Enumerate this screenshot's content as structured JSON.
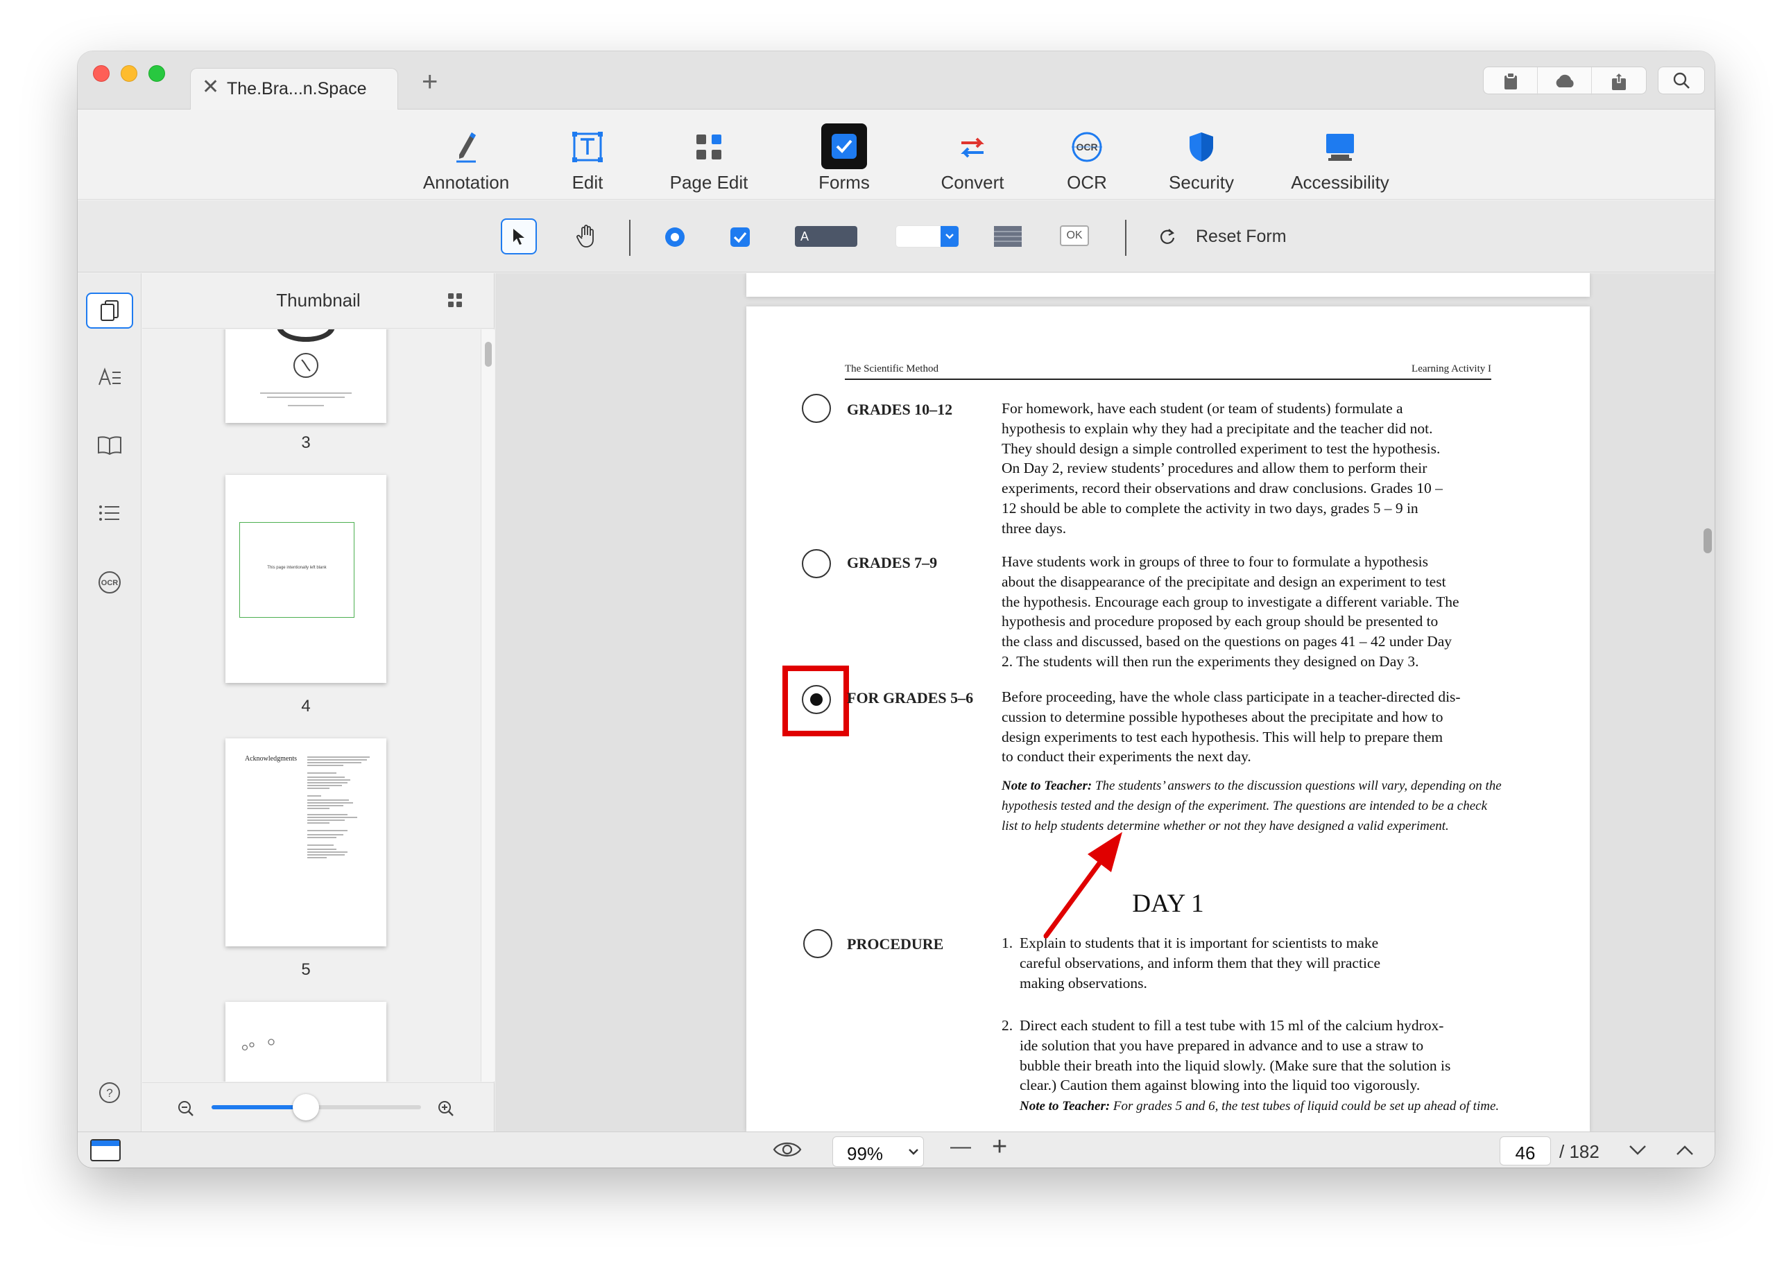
{
  "tab": {
    "title": "The.Bra...n.Space",
    "close": "✕",
    "new": "+"
  },
  "titlebar_buttons": [
    "clipboard-icon",
    "cloud-icon",
    "share-icon"
  ],
  "main_toolbar": [
    {
      "label": "Annotation",
      "icon": "pen-icon"
    },
    {
      "label": "Edit",
      "icon": "text-edit-icon"
    },
    {
      "label": "Page Edit",
      "icon": "grid-icon"
    },
    {
      "label": "Forms",
      "icon": "checkbox-icon",
      "active": true
    },
    {
      "label": "Convert",
      "icon": "convert-icon"
    },
    {
      "label": "OCR",
      "icon": "ocr-icon"
    },
    {
      "label": "Security",
      "icon": "shield-icon"
    },
    {
      "label": "Accessibility",
      "icon": "monitor-icon"
    }
  ],
  "form_toolbar": {
    "tools": [
      "select-arrow",
      "hand",
      "radio-button",
      "checkbox",
      "text-field",
      "dropdown",
      "list-box",
      "button"
    ],
    "text_field_sample": "A",
    "button_sample": "OK",
    "reset_label": "Reset Form"
  },
  "sidebar": {
    "title": "Thumbnail",
    "thumbs": [
      {
        "number": "3"
      },
      {
        "number": "4",
        "text": "This page intentionally left blank"
      },
      {
        "number": "5",
        "heading": "Acknowledgments"
      }
    ],
    "zoom_slider": 0.45
  },
  "document": {
    "header_left": "The Scientific Method",
    "header_right": "Learning Activity I",
    "sections": [
      {
        "heading": "GRADES 10–12",
        "checked": false,
        "lines": [
          "For homework, have each student (or team of students) formulate a",
          "hypothesis to explain why they had a precipitate and the teacher did not.",
          "They should design a simple controlled experiment to test the hypothesis.",
          "On Day 2, review students’ procedures and allow them to perform their",
          "experiments, record their observations and draw conclusions. Grades 10 –",
          "12 should be able to complete the activity in two days, grades 5 – 9 in",
          "three days."
        ]
      },
      {
        "heading": "GRADES 7–9",
        "checked": false,
        "lines": [
          "Have students work in groups of three to four to formulate a hypothesis",
          "about the disappearance of the precipitate and design an experiment to test",
          "the hypothesis. Encourage each group to investigate a different variable. The",
          "hypothesis and procedure proposed by each group should be presented to",
          "the class and discussed, based on the questions on pages 41 – 42 under Day",
          "2. The students will then run the experiments they designed on Day 3."
        ]
      },
      {
        "heading": "FOR GRADES 5–6",
        "checked": true,
        "lines": [
          "Before proceeding, have the whole class participate in a teacher-directed dis-",
          "cussion to determine possible hypotheses about the precipitate and how to",
          "design experiments to test each hypothesis. This will help to prepare them",
          "to conduct their experiments the next day."
        ],
        "note_label": "Note to Teacher:",
        "note_lines": [
          " The students’ answers to the discussion questions will vary, depending on the",
          "hypothesis tested and the design of the experiment.  The questions are intended to be a check",
          "list to help students determine whether or not they have designed a valid experiment."
        ]
      }
    ],
    "day_title": "DAY 1",
    "procedure": {
      "heading": "PROCEDURE",
      "checked": false,
      "items": [
        {
          "num": "1.",
          "lines": [
            "Explain to students that it is important for scientists to make",
            "careful observations, and inform them that they will practice",
            "making observations."
          ]
        },
        {
          "num": "2.",
          "lines": [
            "Direct each student to fill a test tube with 15 ml of the calcium hydrox-",
            "ide solution that you have prepared in advance and to use a straw to",
            "bubble their breath into the liquid slowly. (Make sure that the solution is",
            "clear.) Caution them against blowing into the liquid too vigorously."
          ]
        }
      ],
      "note_label": "Note to Teacher:",
      "note_text": " For grades 5 and 6, the test tubes of liquid could be set up ahead of time."
    }
  },
  "statusbar": {
    "zoom": "99%",
    "current_page": "46",
    "total_pages": "/ 182",
    "minus": "—",
    "plus": "+"
  },
  "colors": {
    "accent": "#1e7bf0",
    "highlight": "#e00000",
    "forms_active_bg": "#111111"
  }
}
